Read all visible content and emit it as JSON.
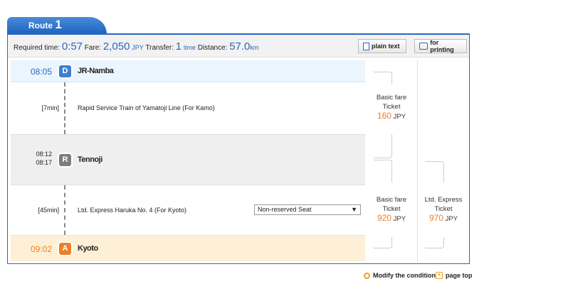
{
  "route_tab": {
    "label": "Route",
    "number": "1"
  },
  "summary": {
    "time_label": "Required time:",
    "time": "0:57",
    "fare_label": "Fare:",
    "fare": "2,050",
    "fare_unit": "JPY",
    "transfer_label": "Transfer:",
    "transfer": "1",
    "transfer_unit": "time",
    "distance_label": "Distance:",
    "distance": "57.0",
    "distance_unit": "km"
  },
  "buttons": {
    "plain_text": "plain text",
    "for_printing": "for printing"
  },
  "stations": [
    {
      "time": "08:05",
      "badge": "D",
      "name": "JR-Namba"
    },
    {
      "arr": "08:12",
      "dep": "08:17",
      "badge": "R",
      "name": "Tennoji"
    },
    {
      "time": "09:02",
      "badge": "A",
      "name": "Kyoto"
    }
  ],
  "segments": [
    {
      "duration": "[7min]",
      "train": "Rapid Service Train of Yamatoji Line (For Kamo)"
    },
    {
      "duration": "[45min]",
      "train": "Ltd. Express Haruka No. 4 (For Kyoto)",
      "seat": "Non-reserved Seat"
    }
  ],
  "fares": [
    {
      "line1": "Basic fare",
      "line2": "Ticket",
      "price": "160",
      "unit": "JPY"
    },
    {
      "line1": "Basic fare",
      "line2": "Ticket",
      "price": "920",
      "unit": "JPY"
    },
    {
      "line1": "Ltd. Express",
      "line2": "Ticket",
      "price": "970",
      "unit": "JPY"
    }
  ],
  "footer": {
    "modify": "Modify the condition",
    "page_top": "page top"
  },
  "colors": {
    "accent": "#2a67c0",
    "orange": "#f07e26"
  }
}
